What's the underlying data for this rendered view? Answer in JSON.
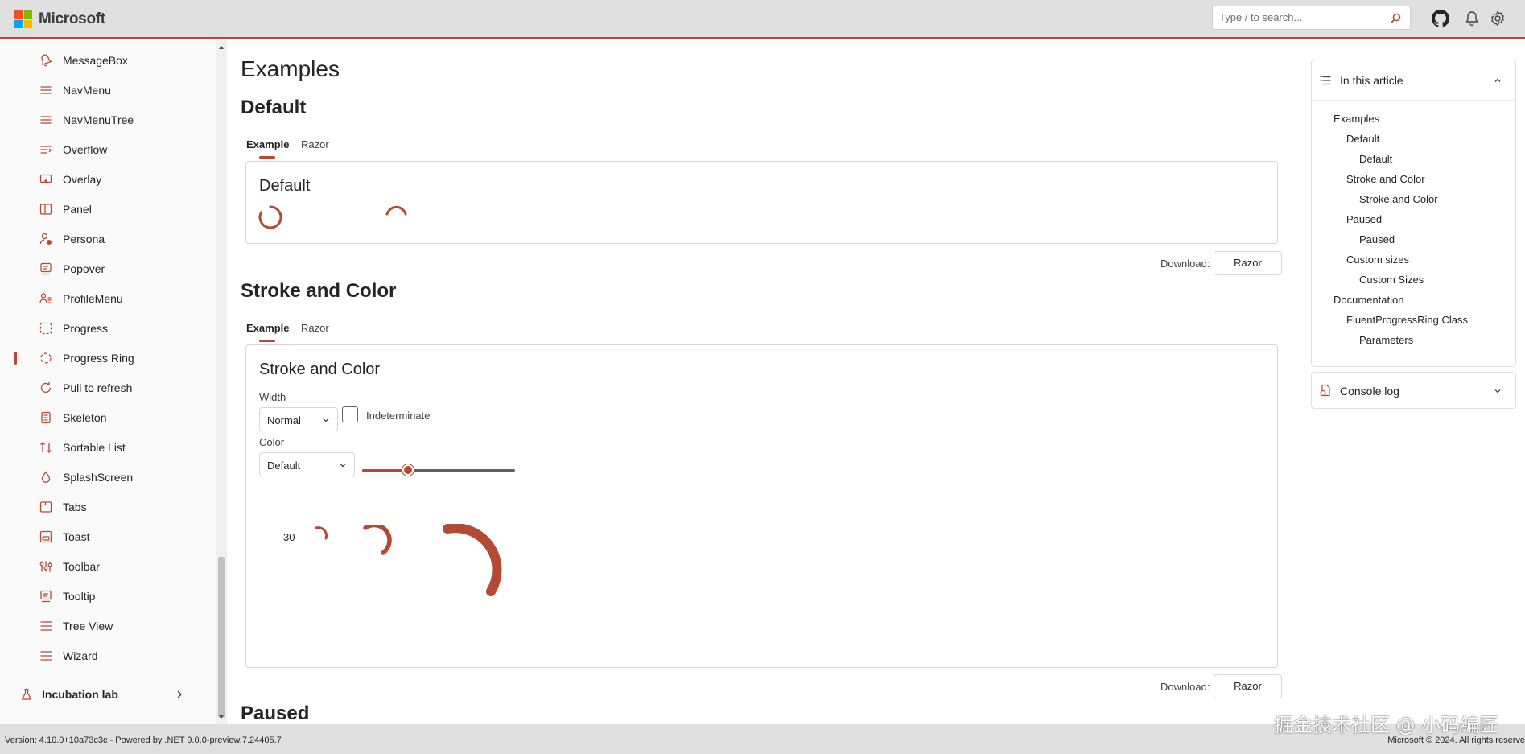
{
  "brand": {
    "name": "Microsoft",
    "logo_colors": [
      "#f25022",
      "#7fba00",
      "#00a4ef",
      "#ffb900"
    ]
  },
  "header": {
    "search_placeholder": "Type / to search...",
    "icons": [
      "github-icon",
      "bell-icon",
      "gear-icon"
    ]
  },
  "accent_color": "#b24a34",
  "sidebar": {
    "items": [
      {
        "label": "MessageBox",
        "icon": "bell-outline-icon"
      },
      {
        "label": "NavMenu",
        "icon": "navigation-icon"
      },
      {
        "label": "NavMenuTree",
        "icon": "navigation-icon"
      },
      {
        "label": "Overflow",
        "icon": "text-overflow-icon"
      },
      {
        "label": "Overlay",
        "icon": "overlay-icon"
      },
      {
        "label": "Panel",
        "icon": "panel-icon"
      },
      {
        "label": "Persona",
        "icon": "persona-icon"
      },
      {
        "label": "Popover",
        "icon": "popover-icon"
      },
      {
        "label": "ProfileMenu",
        "icon": "people-icon"
      },
      {
        "label": "Progress",
        "icon": "progress-icon"
      },
      {
        "label": "Progress Ring",
        "icon": "progress-ring-icon",
        "active": true
      },
      {
        "label": "Pull to refresh",
        "icon": "refresh-icon"
      },
      {
        "label": "Skeleton",
        "icon": "skeleton-icon"
      },
      {
        "label": "Sortable List",
        "icon": "sort-icon"
      },
      {
        "label": "SplashScreen",
        "icon": "drop-icon"
      },
      {
        "label": "Tabs",
        "icon": "tabs-icon"
      },
      {
        "label": "Toast",
        "icon": "toast-icon"
      },
      {
        "label": "Toolbar",
        "icon": "toolbar-icon"
      },
      {
        "label": "Tooltip",
        "icon": "tooltip-icon"
      },
      {
        "label": "Tree View",
        "icon": "tree-icon"
      },
      {
        "label": "Wizard",
        "icon": "wizard-icon"
      }
    ],
    "incubation_label": "Incubation lab"
  },
  "main": {
    "title": "Examples",
    "sections": [
      {
        "heading": "Default",
        "tabs": [
          "Example",
          "Razor"
        ],
        "active_tab": "Example",
        "card_title": "Default",
        "download_label": "Download:",
        "download_button": "Razor"
      },
      {
        "heading": "Stroke and Color",
        "tabs": [
          "Example",
          "Razor"
        ],
        "active_tab": "Example",
        "card_title": "Stroke and Color",
        "width_label": "Width",
        "width_value": "Normal",
        "indeterminate_label": "Indeterminate",
        "indeterminate_checked": false,
        "color_label": "Color",
        "color_value": "Default",
        "slider_value": 30,
        "slider_fraction": 0.3,
        "value_display": "30",
        "download_label": "Download:",
        "download_button": "Razor"
      },
      {
        "heading": "Paused"
      }
    ]
  },
  "toc": {
    "title": "In this article",
    "links": [
      {
        "label": "Examples",
        "level": 0
      },
      {
        "label": "Default",
        "level": 1
      },
      {
        "label": "Default",
        "level": 2
      },
      {
        "label": "Stroke and Color",
        "level": 1
      },
      {
        "label": "Stroke and Color",
        "level": 2
      },
      {
        "label": "Paused",
        "level": 1
      },
      {
        "label": "Paused",
        "level": 2
      },
      {
        "label": "Custom sizes",
        "level": 1
      },
      {
        "label": "Custom Sizes",
        "level": 2
      },
      {
        "label": "Documentation",
        "level": 0
      },
      {
        "label": "FluentProgressRing Class",
        "level": 1
      },
      {
        "label": "Parameters",
        "level": 2
      }
    ]
  },
  "console": {
    "title": "Console log"
  },
  "footer": {
    "version": "Version: 4.10.0+10a73c3c  -  Powered by .NET 9.0.0-preview.7.24405.7",
    "copyright": "Microsoft © 2024. All rights reserve"
  },
  "watermark": "掘金技术社区 @ 小码编匠"
}
